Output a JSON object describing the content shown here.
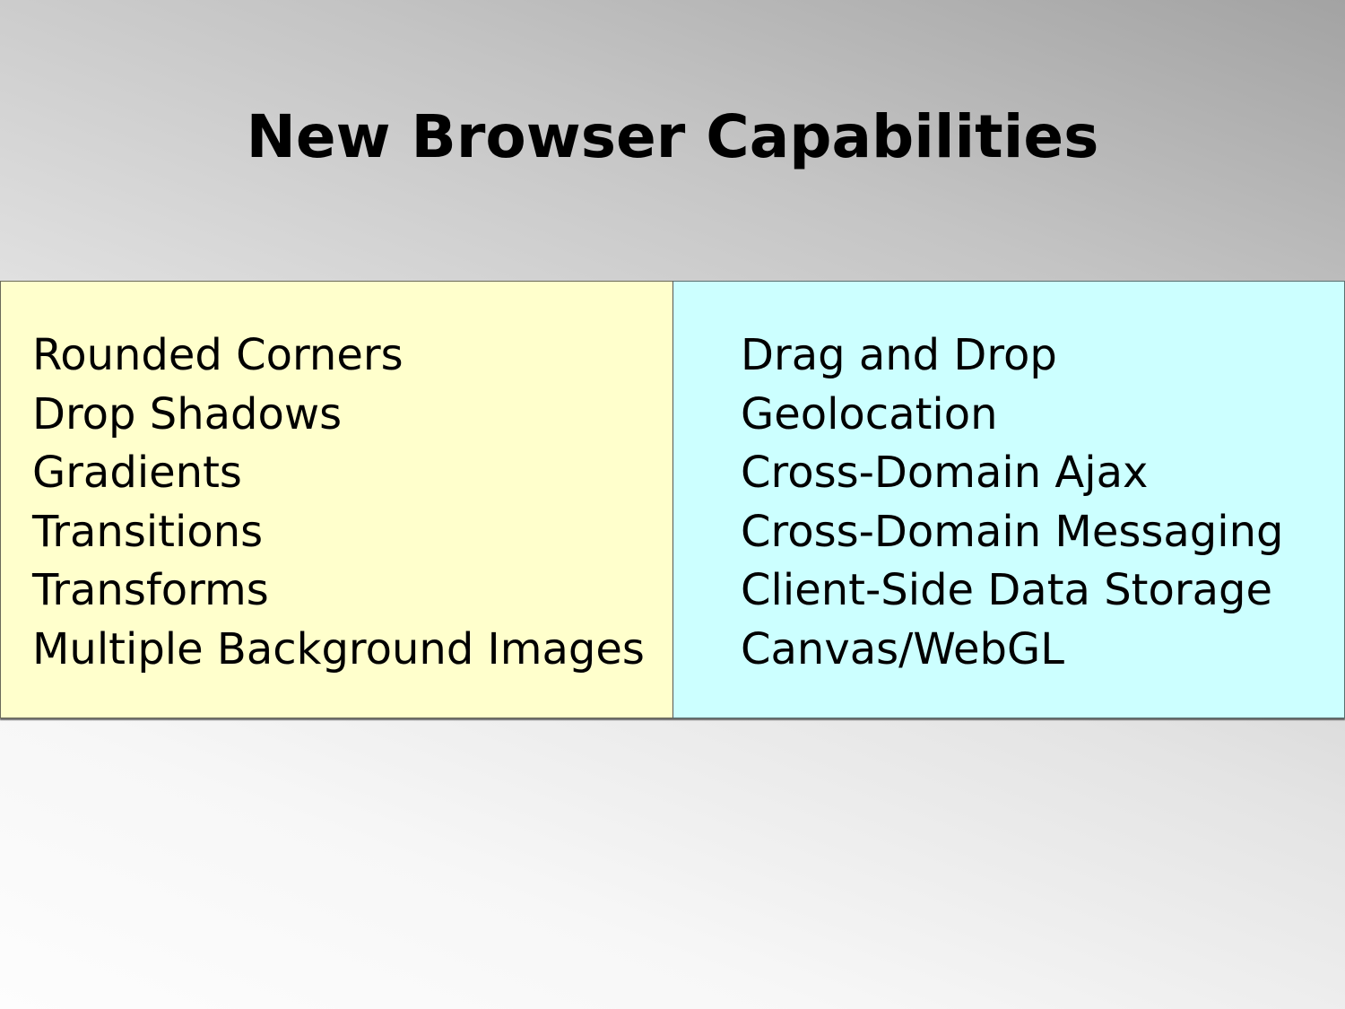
{
  "slide": {
    "title": "New Browser Capabilities"
  },
  "left_column": {
    "background": "#ffffcc",
    "items": [
      "Rounded Corners",
      "Drop Shadows",
      "Gradients",
      "Transitions",
      "Transforms",
      "Multiple Background Images"
    ]
  },
  "right_column": {
    "background": "#ccffff",
    "items": [
      "Drag and Drop",
      "Geolocation",
      "Cross-Domain Ajax",
      "Cross-Domain Messaging",
      "Client-Side Data Storage",
      "Canvas/WebGL"
    ]
  }
}
